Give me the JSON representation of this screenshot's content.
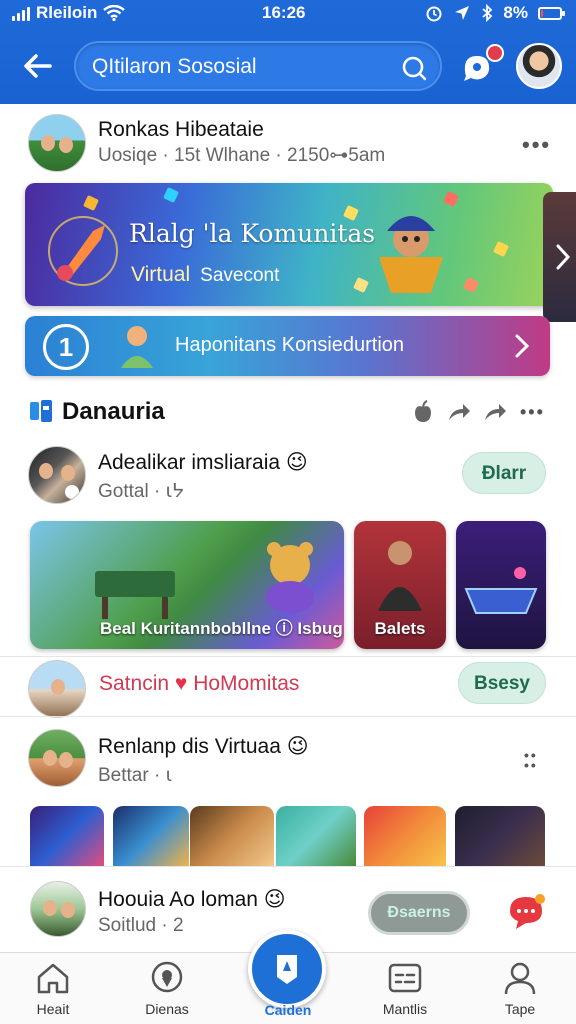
{
  "status_bar": {
    "carrier": "Rleiloin",
    "time": "16:26",
    "battery": "8%",
    "battery_level": 0.08
  },
  "header": {
    "search": {
      "value": "QItilaron Sososial"
    },
    "notification_count": ""
  },
  "post1": {
    "name": "Ronkas Hibeataie",
    "meta": "Uosiqe · 15t Wlhane · 2150⊶5am"
  },
  "banner1": {
    "title": "Rlalg 'la Komunitas",
    "subtitle": "Virtual",
    "subtitle_extra": "Savecont"
  },
  "banner2": {
    "number": "1",
    "text": "Haponitans Konsiedurtion"
  },
  "section": {
    "title": "Danauria"
  },
  "post2": {
    "name": "Adealikar imsliaraia 😉",
    "meta": "Gottal · ⍳ᔭ",
    "button": "Ðlarr",
    "thumbs": [
      {
        "caption": "Beal Kuritannbobllne ⓘ Isbug"
      },
      {
        "caption": "Balets"
      },
      {
        "caption": ""
      }
    ]
  },
  "post3": {
    "text_left": "Satncin",
    "text_right": "HoMomitas",
    "button": "Bsesy"
  },
  "post4": {
    "name": "Renlanp dis Virtuaa 😉",
    "meta": "Bettar · ⍳"
  },
  "composer": {
    "name": "Hoouia Ao loman 😉",
    "meta": "Soitlud · 2",
    "button": "Ðsaerns"
  },
  "bottom_nav": {
    "items": [
      {
        "label": "Heait"
      },
      {
        "label": "Dienas"
      },
      {
        "label": "Caiden"
      },
      {
        "label": "Mantlis"
      },
      {
        "label": "Tape"
      }
    ]
  },
  "colors": {
    "brand": "#1f6ad8",
    "accent": "#1e6fd6",
    "pill": "#d8efe6"
  }
}
